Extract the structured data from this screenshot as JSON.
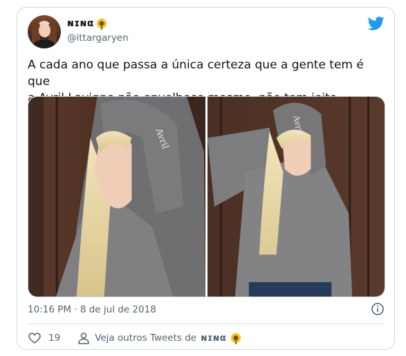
{
  "tweet": {
    "author_name": "ɴɪɴα",
    "author_handle": "@ittargaryen",
    "text_line1": "A cada ano que passa a única certeza que a gente tem é que",
    "text_line2": "a Avril Lavigne não envelhece mesmo, não tem jeito",
    "timestamp": "10:16 PM · 8 de jul de 2018",
    "like_count": "19",
    "more_tweets_label": "Veja outros Tweets de ",
    "more_tweets_name": "ɴɪɴα"
  },
  "icons": {
    "brand": "twitter-bird-icon",
    "emoji": "sunflower-icon",
    "like": "heart-icon",
    "profile": "person-icon",
    "info": "info-icon"
  },
  "colors": {
    "brand": "#1d9bf0",
    "text": "#0f1419",
    "secondary": "#536471",
    "border": "#cfd9de"
  }
}
